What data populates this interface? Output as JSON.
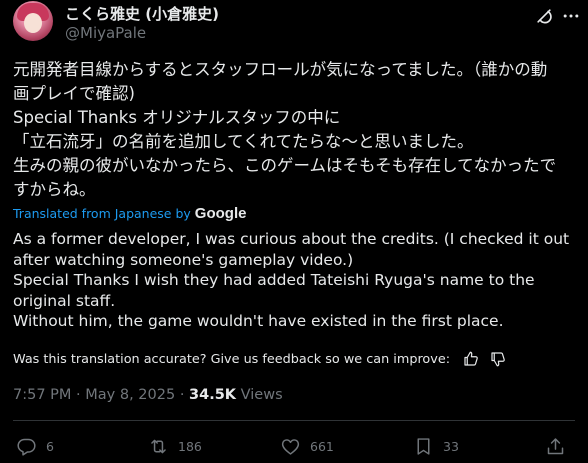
{
  "author": {
    "display_name": "こくら雅史 (小倉雅史)",
    "handle": "@MiyaPale"
  },
  "tweet": {
    "original_lines": [
      "元開発者目線からするとスタッフロールが気になってました。（誰かの動",
      "画プレイで確認)",
      "Special Thanks オリジナルスタッフの中に",
      "「立石流牙」の名前を追加してくれてたらな〜と思いました。",
      "生みの親の彼がいなかったら、このゲームはそもそも存在してなかったで",
      "すからね。"
    ],
    "translated_label": "Translated from Japanese by",
    "translator": "Google",
    "translation_lines": [
      "As a former developer, I was curious about the credits. (I checked it out",
      "after watching someone's gameplay video.)",
      "Special Thanks I wish they had added Tateishi Ryuga's name to the",
      "original staff.",
      "Without him, the game wouldn't have existed in the first place."
    ],
    "feedback_text": "Was this translation accurate? Give us feedback so we can improve:",
    "time": "7:57 PM",
    "date": "May 8, 2025",
    "views_count": "34.5K",
    "views_label": "Views"
  },
  "actions": {
    "replies": "6",
    "reposts": "186",
    "likes": "661",
    "bookmarks": "33"
  },
  "icons": {
    "header": [
      "grok-icon",
      "more-icon"
    ],
    "feedback": [
      "thumbs-up-icon",
      "thumbs-down-icon"
    ],
    "actions": [
      "reply-icon",
      "repost-icon",
      "like-icon",
      "bookmark-icon",
      "share-icon"
    ]
  },
  "colors": {
    "background": "#000000",
    "text": "#e7e9ea",
    "muted": "#71767b",
    "link": "#1d9bf0",
    "divider": "#2f3336"
  }
}
